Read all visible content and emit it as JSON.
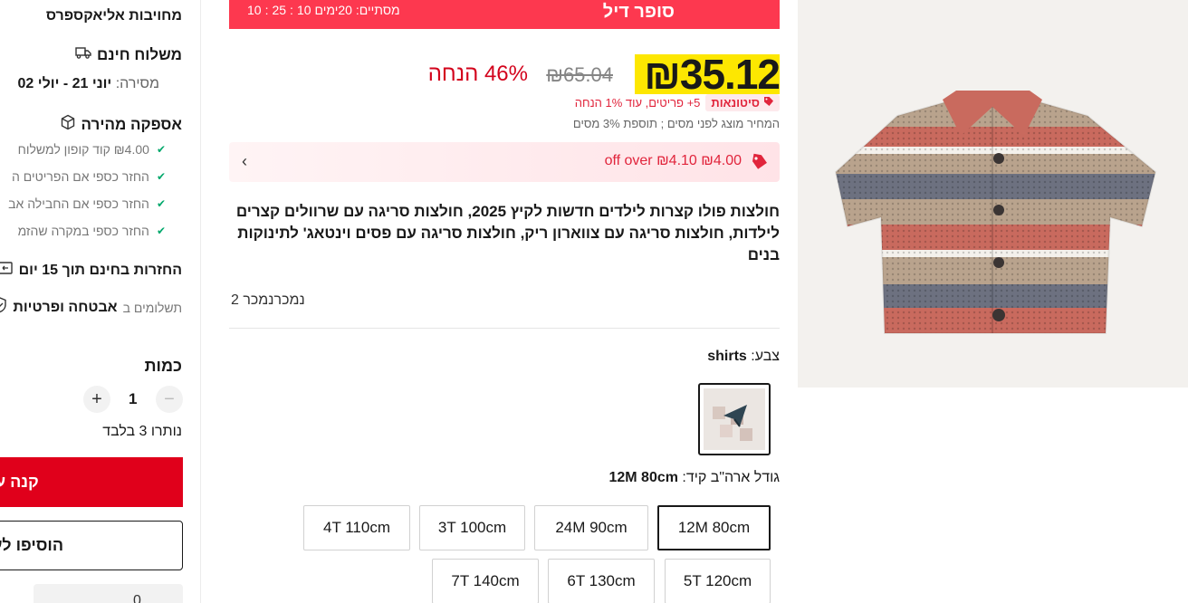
{
  "superdeal": {
    "title": "סופר דיל",
    "ends_label": "מסתיים:",
    "days_label": "20ימים",
    "hours": "10",
    "minutes": "25",
    "seconds": "10",
    "separator": ":"
  },
  "price": {
    "current": "₪35.12",
    "original": "₪65.04",
    "discount": "46% הנחה"
  },
  "wholesale": {
    "badge": "סיטונאות",
    "text": "5+ פריטים, עוד 1% הנחה"
  },
  "tax_note": "המחיר מוצג לפני מסים ; תוספת 3% מסים",
  "coupon": {
    "text": "₪4.00 off over ₪4.10",
    "arrow": "‹"
  },
  "product": {
    "title": "חולצות פולו קצרות לילדים חדשות לקיץ 2025, חולצות סריגה עם שרוולים קצרים לילדות, חולצות סריגה עם צווארון ריק, חולצות סריגה עם פסים וינטאג' לתינוקות בנים",
    "sold": "נמכרנמכר 2"
  },
  "color": {
    "label": "צבע:",
    "value": "shirts"
  },
  "size": {
    "label": "גודל ארה\"ב קיד:",
    "value": "12M 80cm",
    "options": [
      "12M 80cm",
      "24M 90cm",
      "3T 100cm",
      "4T 110cm",
      "5T 120cm",
      "6T 130cm",
      "7T 140cm"
    ]
  },
  "sidebar": {
    "header": "מחויבות אליאקספרס",
    "shipping_title": "משלוח חינם",
    "delivery_label": "מסירה:",
    "delivery_dates": "יוני 21 - יולי 02",
    "fast_title": "אספקה מהירה",
    "checks": [
      "₪4.00 קוד קופון למשלוח",
      "החזר כספי אם הפריטים ה",
      "החזר כספי אם החבילה אב",
      "החזר כספי במקרה שהזמ"
    ],
    "returns_title": "החזרות בחינם תוך 15 יום",
    "security_title": "אבטחה ופרטיות",
    "security_sub": "תשלומים ב",
    "qty_label": "כמות",
    "qty_minus": "−",
    "qty_value": "1",
    "qty_plus": "+",
    "remaining": "נותרו 3 בלבד",
    "buy_now": "קנה עכשיו",
    "add_to_cart": "הוסיפו לעגלה",
    "wishlist_count": "0"
  },
  "colors": {
    "accent_red": "#fd384f",
    "buy_red": "#e0001b",
    "price_highlight": "#fde701",
    "discount_red": "#d3031c",
    "check_green": "#00a86b"
  }
}
